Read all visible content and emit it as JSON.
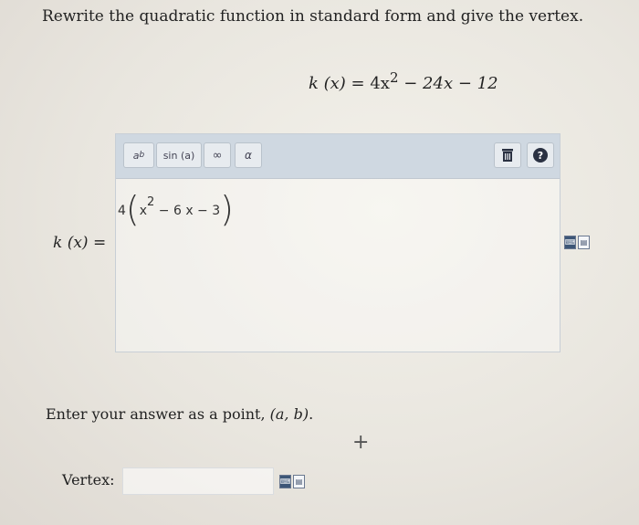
{
  "prompt": "Rewrite the quadratic function in standard form and give the vertex.",
  "formula": {
    "lhs": "k (x) = ",
    "a": "4x",
    "exp": "2",
    "rest": " − 24x − 12"
  },
  "k_label": "k (x) =",
  "toolbar": {
    "power_label": "a",
    "power_sup": "b",
    "sin_label": "sin (a)",
    "infinity_label": "∞",
    "alpha_label": "α",
    "help_label": "?"
  },
  "editor": {
    "coef": "4",
    "open": "(",
    "x": "x",
    "exp": "2",
    "rest": " − 6 x − 3",
    "close": ")"
  },
  "enter_text": {
    "before": "Enter your answer as a point, ",
    "point": "(a, b)",
    "after": "."
  },
  "plus": "+",
  "vertex_label": "Vertex:",
  "vertex_value": "",
  "icons": {
    "keyboard": "keyboard-icon",
    "clipboard": "clipboard-icon",
    "trash": "trash-icon",
    "help": "help-icon"
  }
}
